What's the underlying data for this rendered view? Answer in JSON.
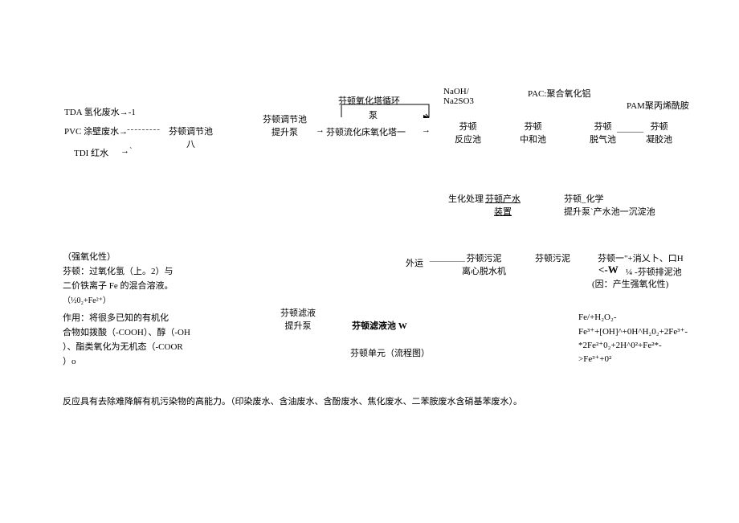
{
  "header": {
    "naoh": "NaOH/\nNa2SO3",
    "pac": "PAC:聚合氧化铝",
    "pam": "PAM聚丙烯酰胺",
    "loop": "芬顿氧化塔循环",
    "pump": "泵"
  },
  "inputs": {
    "tda": "TDA 氢化废水→-1",
    "pvc": "PVC 涂壁废水→",
    "tdi": "TDI 红水",
    "arrow_tdi": "→`",
    "dashline": "---------"
  },
  "blocks": {
    "adjust_tank_1": "芬顿调节池\n八",
    "adjust_tank_2": "芬顿调节池\n提升泵",
    "fluid_tower": "芬顿流化床氧化塔一",
    "arrow_to_tower": "→",
    "arrow_after_tower": "→",
    "react_tank": "芬顿\n反应池",
    "neutral_tank": "芬顿\n中和池",
    "degas_tank": "芬顿\n脱气池",
    "coag_tank": "芬顿\n凝胶池",
    "line_between": "______"
  },
  "mid": {
    "bio": "生化处理",
    "fenton_water": "芬顿产水\n装置",
    "chem": "芬顿_化学\n提升泵`产水池一沉淀池"
  },
  "low": {
    "export": "外运",
    "dash": "————",
    "centrifuge": "芬顿污泥\n离心脱水机",
    "sludge2": "芬顿污泥",
    "slake": "芬顿一\"+消乂卜、口H",
    "w_arrow": "<-W",
    "sludge_tank": "¼ -芬顿排泥池",
    "reason": "(因：产生强氧化性)"
  },
  "bot": {
    "lift": "芬顿滤液\n提升泵",
    "filtrate": "芬顿滤液池 W",
    "unit": "芬顿单元（流程图）"
  },
  "left_note": {
    "l1": "（强氧化性）",
    "l2": "芬顿：过氧化氢（上。2）与",
    "l3": "二价铁离子 Fe 的混合溶液。",
    "l4": "（½0₂+Fe²⁺）",
    "l5": "作用：将很多已知的有机化",
    "l6": "合物如拨酸（-COOH）、醇（-OH",
    "l7": "）、酯类氧化为无机态（-COOR",
    "l8": "）o"
  },
  "right_eq": {
    "e1": "Fe/+H₂O₂-",
    "e2": "Fe³⁺+[OH]^+0H^H₂0₂+2Fe³⁺-",
    "e3": "*2Fe²⁺0₂+2H^0²+Fe²*-",
    "e4": ">Fe³⁺+0²"
  },
  "footer": "反应具有去除难降解有机污染物的高能力。（印染废水、含油废水、含酚废水、焦化废水、二苯胺废水含硝基苯废水）。"
}
